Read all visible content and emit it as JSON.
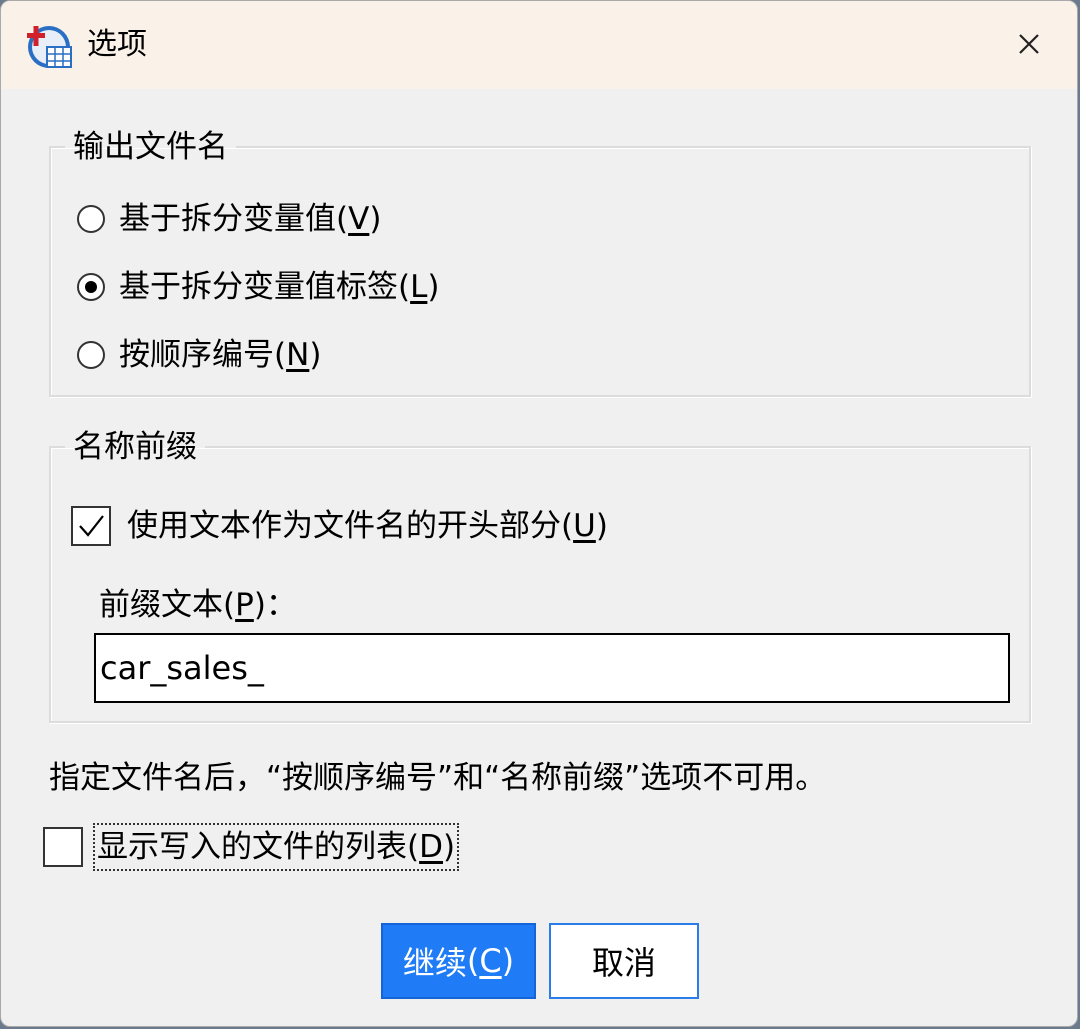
{
  "window": {
    "title": "选项",
    "icon": "spss-app-icon",
    "close_symbol": "✕"
  },
  "output_group": {
    "legend": "输出文件名",
    "options": [
      {
        "label": "基于拆分变量值",
        "mnemonic": "V",
        "checked": false
      },
      {
        "label": "基于拆分变量值标签",
        "mnemonic": "L",
        "checked": true
      },
      {
        "label": "按顺序编号",
        "mnemonic": "N",
        "checked": false
      }
    ]
  },
  "prefix_group": {
    "legend": "名称前缀",
    "use_prefix_label": "使用文本作为文件名的开头部分",
    "use_prefix_mnemonic": "U",
    "use_prefix_checked": true,
    "prefix_text_label": "前缀文本",
    "prefix_text_mnemonic": "P",
    "prefix_text_colon": "：",
    "prefix_value": "car_sales_"
  },
  "note": "指定文件名后，“按顺序编号”和“名称前缀”选项不可用。",
  "show_list": {
    "label": "显示写入的文件的列表",
    "mnemonic": "D",
    "checked": false
  },
  "buttons": {
    "continue_label": "继续",
    "continue_mnemonic": "C",
    "cancel_label": "取消"
  },
  "colors": {
    "primary": "#1f7cf6",
    "titlebar": "#faf1e8",
    "dialog_bg": "#f0f0f0"
  }
}
